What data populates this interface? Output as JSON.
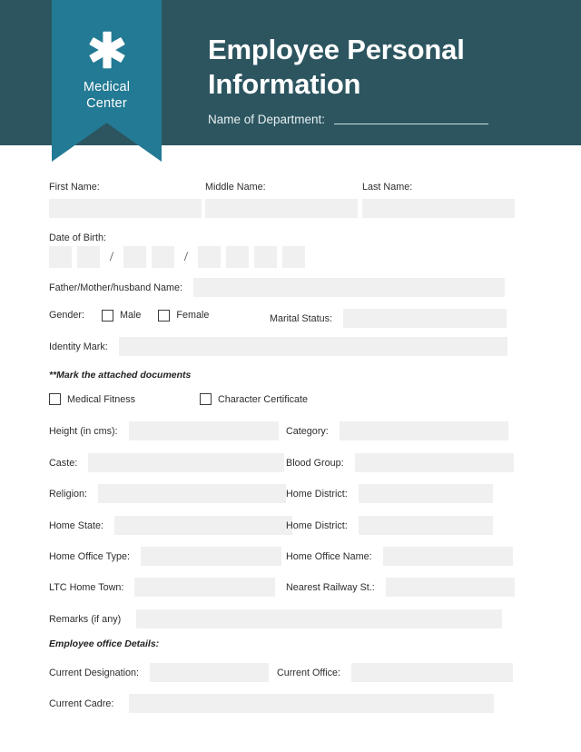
{
  "header": {
    "logo": {
      "icon": "asterisk-medical-icon",
      "line1": "Medical",
      "line2": "Center"
    },
    "title_line1": "Employee Personal",
    "title_line2": "Information",
    "department_label": "Name of Department:",
    "department_value": "",
    "colors": {
      "dark_teal": "#2c5560",
      "ribbon_teal": "#237a94",
      "field_gray": "#f0f0f0"
    }
  },
  "form": {
    "names": [
      {
        "label": "First Name:",
        "value": ""
      },
      {
        "label": "Middle Name:",
        "value": ""
      },
      {
        "label": "Last Name:",
        "value": ""
      }
    ],
    "dob": {
      "label": "Date of Birth:",
      "separator": "/",
      "boxes": [
        "",
        "",
        "",
        "",
        "",
        "",
        "",
        ""
      ]
    },
    "parent_name": {
      "label": "Father/Mother/husband Name:",
      "value": ""
    },
    "gender": {
      "label": "Gender:",
      "options": [
        {
          "label": "Male",
          "checked": false
        },
        {
          "label": "Female",
          "checked": false
        }
      ]
    },
    "marital_status": {
      "label": "Marital Status:",
      "value": ""
    },
    "identity_mark": {
      "label": "Identity Mark:",
      "value": ""
    },
    "attached_note": "**Mark the attached documents",
    "attached_docs": [
      {
        "label": "Medical Fitness",
        "checked": false
      },
      {
        "label": "Character Certificate",
        "checked": false
      }
    ],
    "pairs": [
      [
        {
          "label": "Height (in cms):",
          "value": ""
        },
        {
          "label": "Category:",
          "value": ""
        }
      ],
      [
        {
          "label": "Caste:",
          "value": ""
        },
        {
          "label": "Blood Group:",
          "value": ""
        }
      ],
      [
        {
          "label": "Religion:",
          "value": ""
        },
        {
          "label": "Home District:",
          "value": ""
        }
      ],
      [
        {
          "label": "Home State:",
          "value": ""
        },
        {
          "label": "Home District:",
          "value": ""
        }
      ],
      [
        {
          "label": "Home Office Type:",
          "value": ""
        },
        {
          "label": "Home Office Name:",
          "value": ""
        }
      ],
      [
        {
          "label": "LTC Home Town:",
          "value": ""
        },
        {
          "label": "Nearest Railway St.:",
          "value": ""
        }
      ]
    ],
    "remarks": {
      "label": "Remarks (if any)",
      "value": ""
    },
    "office_section_title": "Employee office Details:",
    "office_pair": [
      {
        "label": "Current Designation:",
        "value": ""
      },
      {
        "label": "Current Office:",
        "value": ""
      }
    ],
    "current_cadre": {
      "label": "Current Cadre:",
      "value": ""
    }
  }
}
